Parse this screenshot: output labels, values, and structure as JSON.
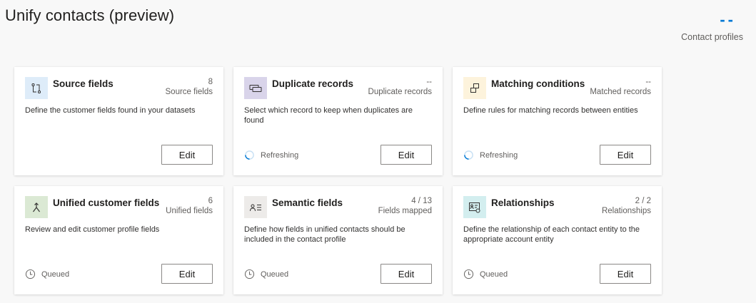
{
  "page": {
    "title": "Unify contacts (preview)"
  },
  "summary": {
    "value": "--",
    "label": "Contact profiles",
    "accent": "#0078d4"
  },
  "cards": [
    {
      "title": "Source fields",
      "metric_value": "8",
      "metric_label": "Source fields",
      "description": "Define the customer fields found in your datasets",
      "status": "",
      "icon": "source-fields-icon",
      "icon_bg": "#deecf9",
      "button": "Edit"
    },
    {
      "title": "Duplicate records",
      "metric_value": "--",
      "metric_label": "Duplicate records",
      "description": "Select which record to keep when duplicates are found",
      "status": "Refreshing",
      "icon": "duplicate-records-icon",
      "icon_bg": "#d9d4ea",
      "button": "Edit"
    },
    {
      "title": "Matching conditions",
      "metric_value": "--",
      "metric_label": "Matched records",
      "description": "Define rules for matching records between entities",
      "status": "Refreshing",
      "icon": "matching-conditions-icon",
      "icon_bg": "#fdf3dc",
      "button": "Edit"
    },
    {
      "title": "Unified customer fields",
      "metric_value": "6",
      "metric_label": "Unified fields",
      "description": "Review and edit customer profile fields",
      "status": "Queued",
      "icon": "merge-icon",
      "icon_bg": "#dbe9d4",
      "button": "Edit"
    },
    {
      "title": "Semantic fields",
      "metric_value": "4 / 13",
      "metric_label": "Fields mapped",
      "description": "Define how fields in unified contacts should be included in the contact profile",
      "status": "Queued",
      "icon": "semantic-fields-icon",
      "icon_bg": "#edebe9",
      "button": "Edit"
    },
    {
      "title": "Relationships",
      "metric_value": "2 / 2",
      "metric_label": "Relationships",
      "description": "Define the relationship of each contact entity to the appropriate account entity",
      "status": "Queued",
      "icon": "relationships-icon",
      "icon_bg": "#d3eeef",
      "button": "Edit"
    }
  ]
}
